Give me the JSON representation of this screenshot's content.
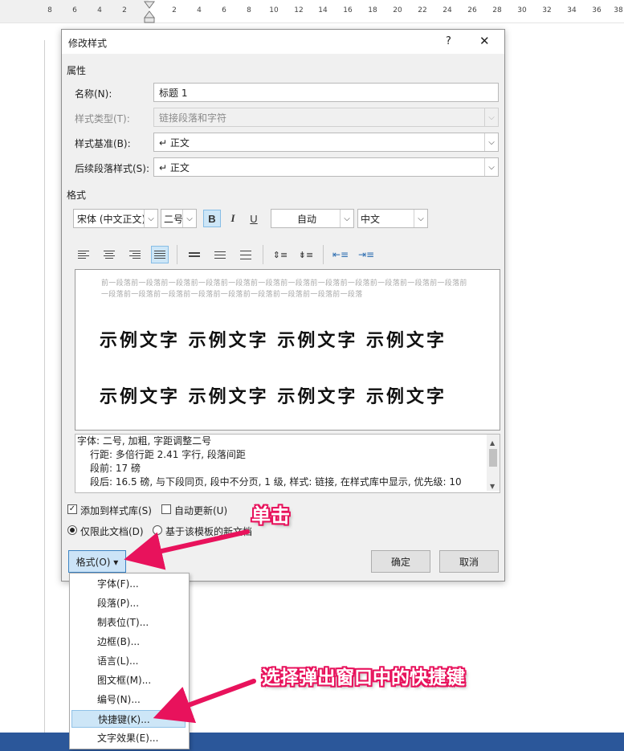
{
  "ruler": {
    "labels": [
      "8",
      "6",
      "4",
      "2",
      "2",
      "4",
      "6",
      "8",
      "10",
      "12",
      "14",
      "16",
      "18",
      "20",
      "22",
      "24",
      "26",
      "28",
      "30",
      "32",
      "34",
      "36",
      "38"
    ]
  },
  "dialog": {
    "title": "修改样式",
    "help": "?",
    "close": "✕",
    "props_section": "属性",
    "name_label": "名称(N):",
    "name_value": "标题 1",
    "type_label": "样式类型(T):",
    "type_value": "链接段落和字符",
    "base_label": "样式基准(B):",
    "base_value": "↵ 正文",
    "next_label": "后续段落样式(S):",
    "next_value": "↵ 正文",
    "format_section": "格式",
    "font": "宋体 (中文正文)",
    "size": "二号",
    "bold": "B",
    "italic": "I",
    "underline": "U",
    "color": "自动",
    "lang": "中文",
    "preview_prev": "前一段落前一段落前一段落前一段落前一段落前一段落前一段落前一段落前一段落前一段落前一段落前一段落前一段落前一段落前一段落前一段落前一段落前一段落前一段落前一段落前一段落",
    "sample_line1": "示例文字 示例文字 示例文字 示例文字",
    "sample_line2": "示例文字 示例文字 示例文字 示例文字",
    "desc": [
      "字体: 二号, 加粗, 字距调整二号",
      "行距: 多倍行距 2.41 字行, 段落间距",
      "段前: 17 磅",
      "段后: 16.5 磅, 与下段同页, 段中不分页, 1 级, 样式: 链接, 在样式库中显示, 优先级: 10"
    ],
    "add_to_gallery": "添加到样式库(S)",
    "auto_update": "自动更新(U)",
    "only_this_doc": "仅限此文档(D)",
    "new_docs": "基于该模板的新文档",
    "format_btn": "格式(O) ▾",
    "ok": "确定",
    "cancel": "取消"
  },
  "menu": {
    "items": [
      "字体(F)...",
      "段落(P)...",
      "制表位(T)...",
      "边框(B)...",
      "语言(L)...",
      "图文框(M)...",
      "编号(N)...",
      "快捷键(K)...",
      "文字效果(E)..."
    ]
  },
  "annotations": {
    "click": "单击",
    "choose": "选择弹出窗口中的快捷键"
  },
  "colors": {
    "accent": "#e8125c",
    "word_blue": "#2b579a",
    "highlight": "#cde6f7"
  }
}
